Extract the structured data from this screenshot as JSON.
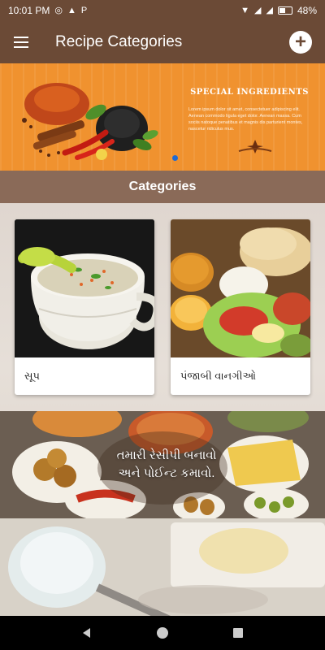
{
  "status_bar": {
    "time": "10:01 PM",
    "battery": "48%"
  },
  "app_bar": {
    "title": "Recipe Categories"
  },
  "banner": {
    "title": "SPECIAL INGREDIENTS",
    "text": "Lorem ipsum dolor sit amet, consectetuer adipiscing elit. Aenean commodo ligula eget dolor. Aenean massa. Cum sociis natoque penatibus et magnis dis parturient montes, nascetur ridiculus mus."
  },
  "section": {
    "title": "Categories"
  },
  "categories": [
    {
      "label": "સૂપ"
    },
    {
      "label": "પંજાબી વાનગીઓ"
    }
  ],
  "promo": {
    "line1": "તમારી રેસીપી બનાવો",
    "line2": "અને પોઈન્ટ કમાવો."
  },
  "colors": {
    "app_bar": "#6b4a36",
    "banner": "#f0922f",
    "section_header": "#8a6a58",
    "pager_dot": "#1e6ad4"
  }
}
